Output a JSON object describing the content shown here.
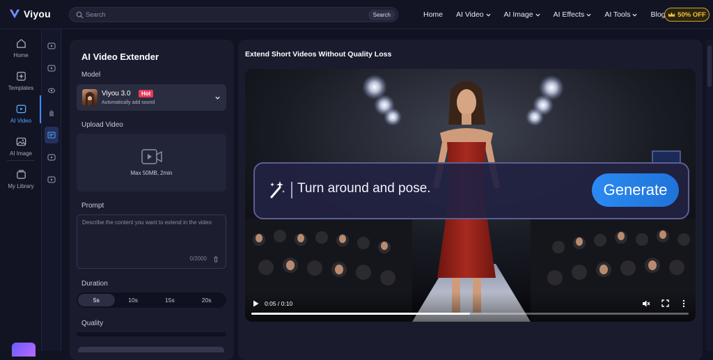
{
  "header": {
    "brand": "Viyou",
    "search_placeholder": "Search",
    "search_button": "Search",
    "nav": [
      {
        "label": "Home",
        "has_menu": false
      },
      {
        "label": "AI Video",
        "has_menu": true
      },
      {
        "label": "AI Image",
        "has_menu": true
      },
      {
        "label": "AI Effects",
        "has_menu": true
      },
      {
        "label": "AI Tools",
        "has_menu": true
      },
      {
        "label": "Blogs",
        "has_menu": false
      }
    ],
    "promo": "50% OFF"
  },
  "sidebar": {
    "items": [
      {
        "label": "Home",
        "icon": "home-icon"
      },
      {
        "label": "Templates",
        "icon": "templates-icon"
      },
      {
        "label": "AI Video",
        "icon": "video-icon",
        "active": true
      },
      {
        "label": "AI Image",
        "icon": "image-icon"
      },
      {
        "label": "My Library",
        "icon": "library-icon"
      }
    ]
  },
  "tool": {
    "title": "AI Video Extender",
    "model_label": "Model",
    "model": {
      "name": "Viyou 3.0",
      "badge": "Hot",
      "subtitle": "Automatically add sound"
    },
    "upload_label": "Upload Video",
    "upload_hint": "Max 50MB, 2min",
    "prompt_label": "Prompt",
    "prompt_placeholder": "Describe the content you want to extend in the video",
    "prompt_count": "0/2000",
    "duration_label": "Duration",
    "durations": [
      "5s",
      "10s",
      "15s",
      "20s"
    ],
    "duration_selected": "5s",
    "quality_label": "Quality"
  },
  "main": {
    "title": "Extend Short Videos Without Quality Loss",
    "overlay_prompt": "Turn around and pose.",
    "generate_label": "Generate",
    "player": {
      "time": "0:05 / 0:10",
      "progress": 0.5
    }
  },
  "colors": {
    "accent": "#3a8dff",
    "hot": "#e53a5a",
    "promo": "#f2c33a",
    "generate": "#2b8af2"
  }
}
